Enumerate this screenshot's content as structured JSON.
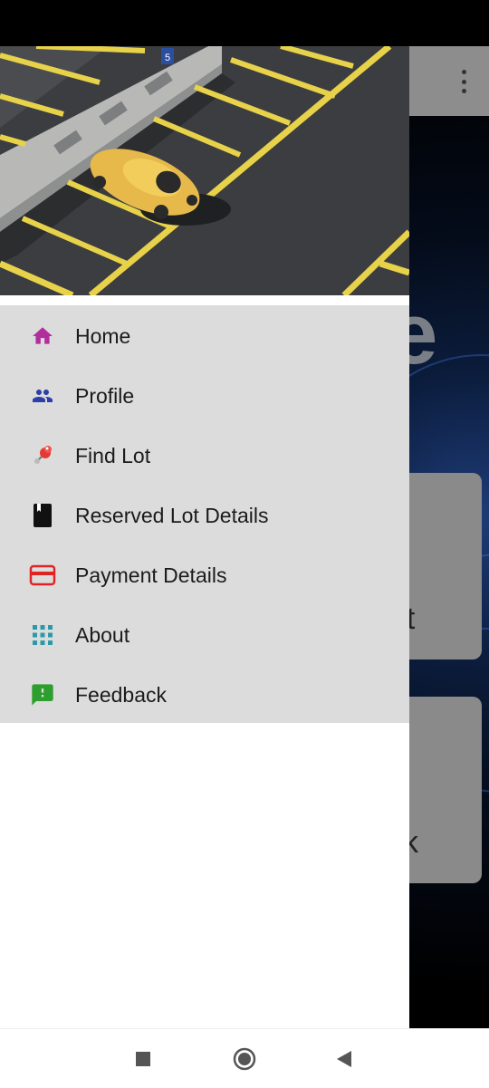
{
  "menu": {
    "items": [
      {
        "label": "Home",
        "icon": "home-icon",
        "color": "#b02f9c"
      },
      {
        "label": "Profile",
        "icon": "people-icon",
        "color": "#2d3fa8"
      },
      {
        "label": "Find Lot",
        "icon": "pushpin-icon",
        "color": "#e53935"
      },
      {
        "label": "Reserved Lot Details",
        "icon": "book-icon",
        "color": "#111111"
      },
      {
        "label": "Payment Details",
        "icon": "credit-card-icon",
        "color": "#e02424"
      },
      {
        "label": "About",
        "icon": "apps-grid-icon",
        "color": "#2b9aa8"
      },
      {
        "label": "Feedback",
        "icon": "feedback-icon",
        "color": "#2e9e2e"
      }
    ]
  },
  "background": {
    "big_text": "e",
    "card1_label": "ot",
    "card2_label": "ck"
  },
  "header_image": {
    "lot_number": "5"
  }
}
